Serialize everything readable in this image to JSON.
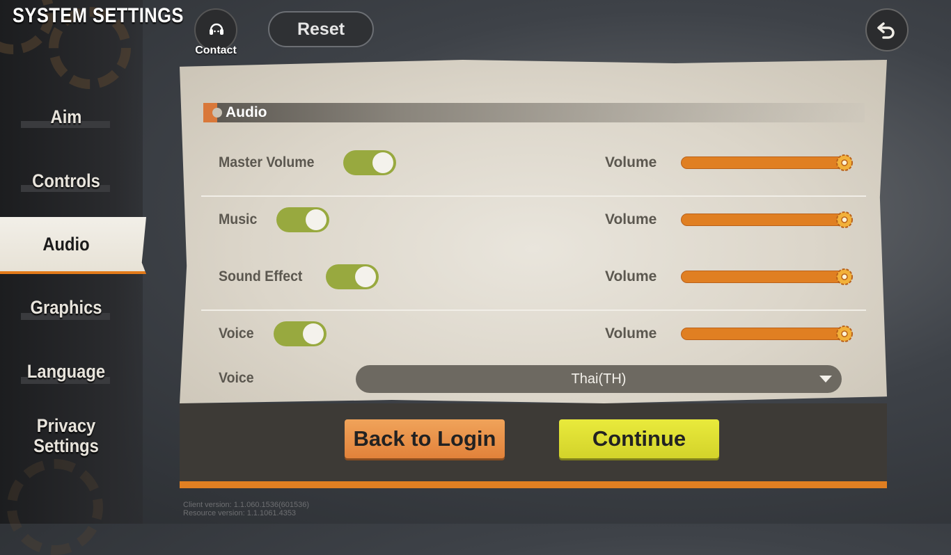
{
  "header": {
    "title": "SYSTEM SETTINGS",
    "contact_label": "Contact",
    "reset_label": "Reset"
  },
  "sidebar": {
    "items": [
      {
        "label": "Aim"
      },
      {
        "label": "Controls"
      },
      {
        "label": "Audio",
        "active": true
      },
      {
        "label": "Graphics"
      },
      {
        "label": "Language"
      },
      {
        "label": "Privacy\nSettings"
      }
    ]
  },
  "audio": {
    "section_title": "Audio",
    "rows": [
      {
        "label": "Master Volume",
        "enabled": true,
        "volume_label": "Volume",
        "volume": 1.0
      },
      {
        "label": "Music",
        "enabled": true,
        "volume_label": "Volume",
        "volume": 1.0
      },
      {
        "label": "Sound Effect",
        "enabled": true,
        "volume_label": "Volume",
        "volume": 1.0
      },
      {
        "label": "Voice",
        "enabled": true,
        "volume_label": "Volume",
        "volume": 1.0
      }
    ],
    "voice_language_label": "Voice",
    "voice_language_value": "Thai(TH)"
  },
  "footer": {
    "back_to_login_label": "Back to Login",
    "continue_label": "Continue",
    "client_version": "Client version: 1.1.060.1536(601536)",
    "resource_version": "Resource version: 1.1.1061.4353"
  },
  "colors": {
    "accent_orange": "#e07f22",
    "toggle_green": "#98a93f",
    "continue_yellow": "#d3d32a"
  }
}
